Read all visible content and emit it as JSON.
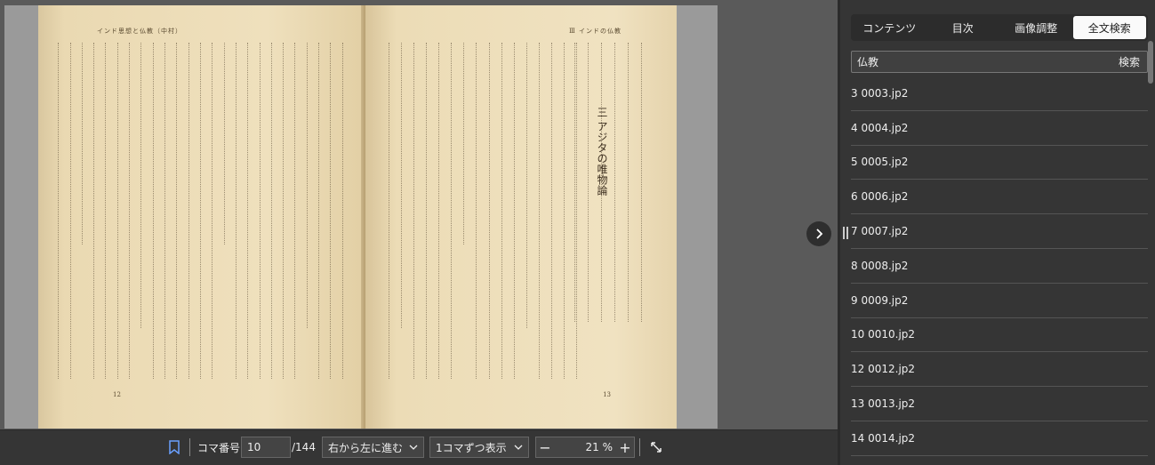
{
  "book": {
    "left_running_head": "インド思想と仏教（中村）",
    "right_running_head": "Ⅲ インドの仏教",
    "chapter_heading": "三 アジタの唯物論",
    "left_page_number": "12",
    "right_page_number": "13"
  },
  "toolbar": {
    "frame_label": "コマ番号",
    "frame_value": "10",
    "frame_total": "/144",
    "direction_select": "右から左に進む",
    "display_select": "1コマずつ表示",
    "zoom_value": "21 %"
  },
  "panel": {
    "tabs": [
      {
        "label": "コンテンツ"
      },
      {
        "label": "目次"
      },
      {
        "label": "画像調整"
      },
      {
        "label": "全文検索"
      }
    ],
    "search_value": "仏教",
    "search_button": "検索",
    "results": [
      "3 0003.jp2",
      "4 0004.jp2",
      "5 0005.jp2",
      "6 0006.jp2",
      "7 0007.jp2",
      "8 0008.jp2",
      "9 0009.jp2",
      "10 0010.jp2",
      "12 0012.jp2",
      "13 0013.jp2",
      "14 0014.jp2"
    ]
  }
}
